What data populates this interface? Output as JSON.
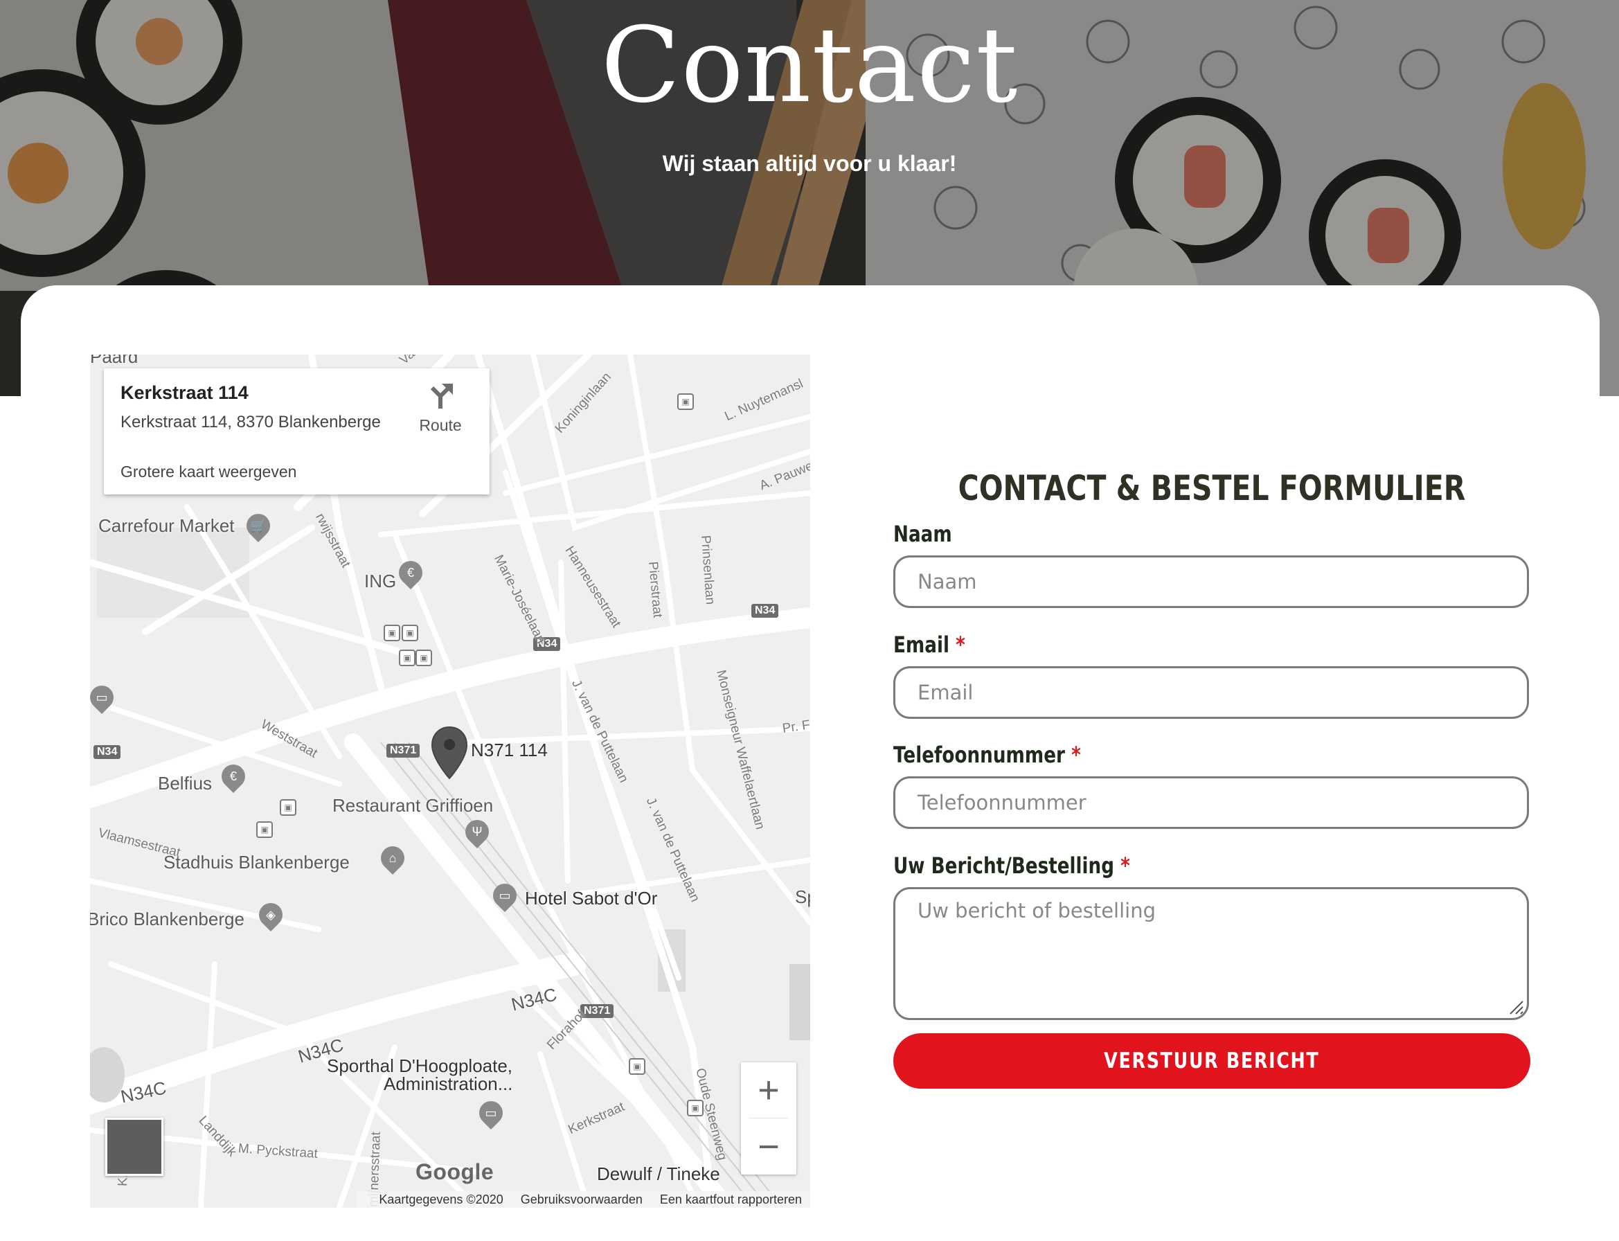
{
  "hero": {
    "title": "Contact",
    "subtitle": "Wij staan altijd voor u klaar!"
  },
  "map": {
    "info": {
      "title": "Kerkstraat 114",
      "address": "Kerkstraat 114, 8370 Blankenberge",
      "route_label": "Route",
      "larger_map_link": "Grotere kaart weergeven"
    },
    "places": [
      "Paard",
      "Carrefour Market",
      "ING",
      "N371 114",
      "Restaurant Griffioen",
      "Belfius",
      "Stadhuis Blankenberge",
      "Hotel Sabot d'Or",
      "Brico Blankenberge",
      "Sporthal D'Hoogploate,",
      "Administration...",
      "Dewulf / Tineke",
      "N34C",
      "N34C",
      "N34C",
      "Sp"
    ],
    "streets": [
      "Koninginlaan",
      "L. Nuytemansl",
      "A. Pauwe",
      "Marie-Joséelaan",
      "Hanneusestraat",
      "Pierstraat",
      "Prinsenlaan",
      "J. van de Puttelaan",
      "J. van de Puttelaan",
      "Monseigneur Waffelaertlaan",
      "Weststraat",
      "Vlaamsestraat",
      "Pr. F",
      "Florahof",
      "Kerkstraat",
      "Oude Steenweg",
      "M. Pyckstraat",
      "Landdijk",
      "rwijsstraat",
      "Va",
      "K. D",
      "mijnersstraat"
    ],
    "road_badges": [
      "N34",
      "N34",
      "N34",
      "N371",
      "N371"
    ],
    "zoom_in": "+",
    "zoom_out": "−",
    "google_logo": "Google",
    "attribution": {
      "data": "Kaartgegevens ©2020",
      "terms": "Gebruiksvoorwaarden",
      "report": "Een kaartfout rapporteren"
    }
  },
  "form": {
    "heading": "CONTACT & BESTEL FORMULIER",
    "fields": [
      {
        "label": "Naam",
        "required": false,
        "placeholder": "Naam"
      },
      {
        "label": "Email",
        "required": true,
        "placeholder": "Email"
      },
      {
        "label": "Telefoonnummer",
        "required": true,
        "placeholder": "Telefoonnummer"
      },
      {
        "label": "Uw Bericht/Bestelling",
        "required": true,
        "placeholder": "Uw bericht of bestelling"
      }
    ],
    "required_mark": "*",
    "submit_label": "VERSTUUR BERICHT"
  },
  "colors": {
    "accent": "#e1141e",
    "heading": "#2d3225",
    "required": "#d81c22"
  },
  "icons": [
    "route-icon",
    "map-pin-icon",
    "zoom-in-icon",
    "zoom-out-icon",
    "resize-grip-icon"
  ]
}
